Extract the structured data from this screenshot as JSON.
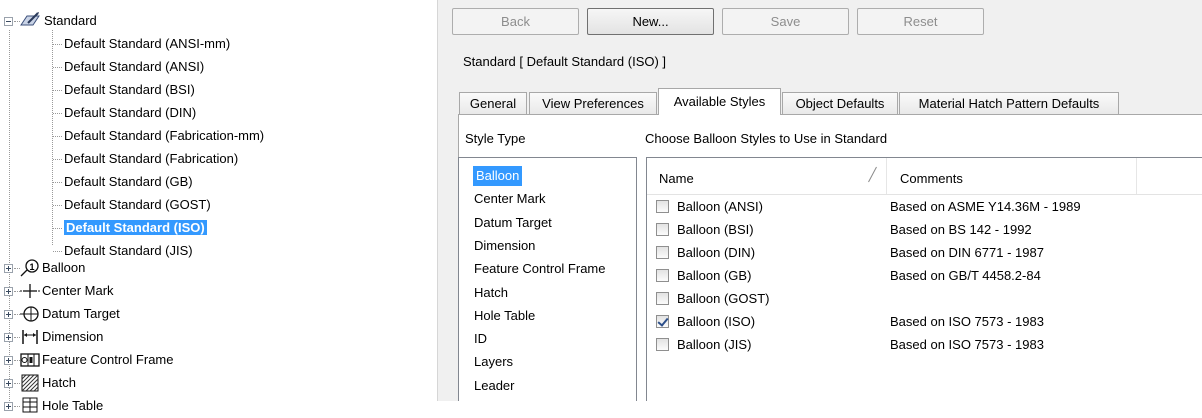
{
  "tree": {
    "root": {
      "label": "Standard",
      "icon": "standard-icon",
      "expanded": true
    },
    "standards": [
      "Default Standard (ANSI-mm)",
      "Default Standard (ANSI)",
      "Default Standard (BSI)",
      "Default Standard (DIN)",
      "Default Standard (Fabrication-mm)",
      "Default Standard (Fabrication)",
      "Default Standard (GB)",
      "Default Standard (GOST)",
      "Default Standard (ISO)",
      "Default Standard (JIS)"
    ],
    "selected_standard": "Default Standard (ISO)",
    "categories": [
      {
        "label": "Balloon",
        "icon": "balloon-icon"
      },
      {
        "label": "Center Mark",
        "icon": "center-mark-icon"
      },
      {
        "label": "Datum Target",
        "icon": "datum-target-icon"
      },
      {
        "label": "Dimension",
        "icon": "dimension-icon"
      },
      {
        "label": "Feature Control Frame",
        "icon": "feature-control-frame-icon"
      },
      {
        "label": "Hatch",
        "icon": "hatch-icon"
      },
      {
        "label": "Hole Table",
        "icon": "hole-table-icon"
      }
    ]
  },
  "toolbar": {
    "back": "Back",
    "new": "New...",
    "save": "Save",
    "reset": "Reset"
  },
  "standard_title": "Standard [ Default Standard (ISO) ]",
  "tabs": [
    "General",
    "View Preferences",
    "Available Styles",
    "Object Defaults",
    "Material Hatch Pattern Defaults"
  ],
  "active_tab": "Available Styles",
  "style_type_label": "Style Type",
  "style_types": [
    "Balloon",
    "Center Mark",
    "Datum Target",
    "Dimension",
    "Feature Control Frame",
    "Hatch",
    "Hole Table",
    "ID",
    "Layers",
    "Leader"
  ],
  "selected_style_type": "Balloon",
  "choose_label": "Choose Balloon Styles to Use in Standard",
  "grid": {
    "columns": [
      "Name",
      "Comments"
    ],
    "rows": [
      {
        "name": "Balloon (ANSI)",
        "comment": "Based on ASME Y14.36M - 1989",
        "checked": false
      },
      {
        "name": "Balloon (BSI)",
        "comment": "Based on BS 142 - 1992",
        "checked": false
      },
      {
        "name": "Balloon (DIN)",
        "comment": "Based on DIN 6771 - 1987",
        "checked": false
      },
      {
        "name": "Balloon (GB)",
        "comment": "Based on GB/T 4458.2-84",
        "checked": false
      },
      {
        "name": "Balloon (GOST)",
        "comment": "",
        "checked": false
      },
      {
        "name": "Balloon (ISO)",
        "comment": "Based on ISO 7573 - 1983",
        "checked": true
      },
      {
        "name": "Balloon (JIS)",
        "comment": "Based on ISO 7573 - 1983",
        "checked": false
      }
    ]
  },
  "colors": {
    "selection": "#3399ff",
    "panel_bg": "#f0f0f0",
    "border": "#828790"
  }
}
